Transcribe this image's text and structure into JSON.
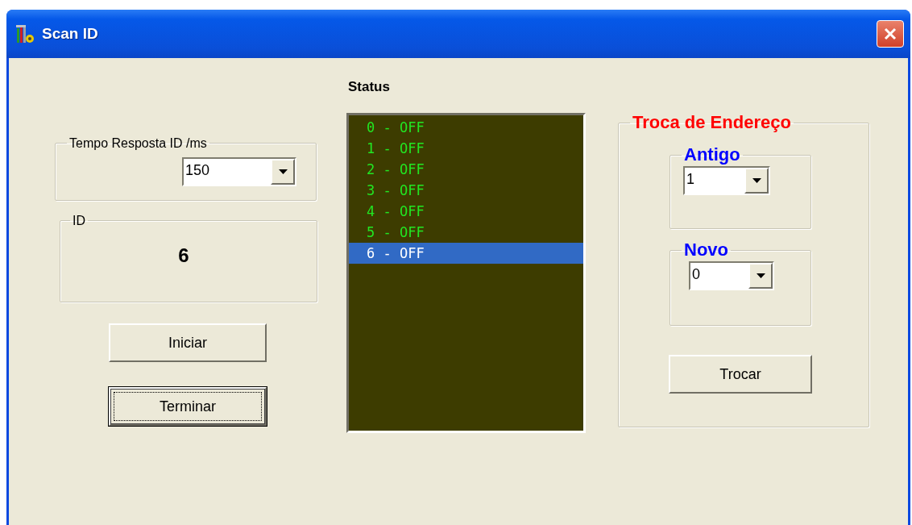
{
  "window": {
    "title": "Scan ID"
  },
  "response_time": {
    "label": "Tempo Resposta ID /ms",
    "value": "150"
  },
  "id_box": {
    "label": "ID",
    "value": "6"
  },
  "buttons": [
    {
      "label": "Iniciar",
      "focused": false
    },
    {
      "label": "Terminar",
      "focused": true
    }
  ],
  "status": {
    "label": "Status",
    "items": [
      {
        "text": "0 - OFF",
        "selected": false
      },
      {
        "text": "1 - OFF",
        "selected": false
      },
      {
        "text": "2 - OFF",
        "selected": false
      },
      {
        "text": "3 - OFF",
        "selected": false
      },
      {
        "text": "4 - OFF",
        "selected": false
      },
      {
        "text": "5 - OFF",
        "selected": false
      },
      {
        "text": "6 - OFF",
        "selected": true
      }
    ]
  },
  "address_change": {
    "title": "Troca de Endereço",
    "old": {
      "label": "Antigo",
      "value": "1"
    },
    "new": {
      "label": "Novo",
      "value": "0"
    },
    "button": "Trocar"
  }
}
